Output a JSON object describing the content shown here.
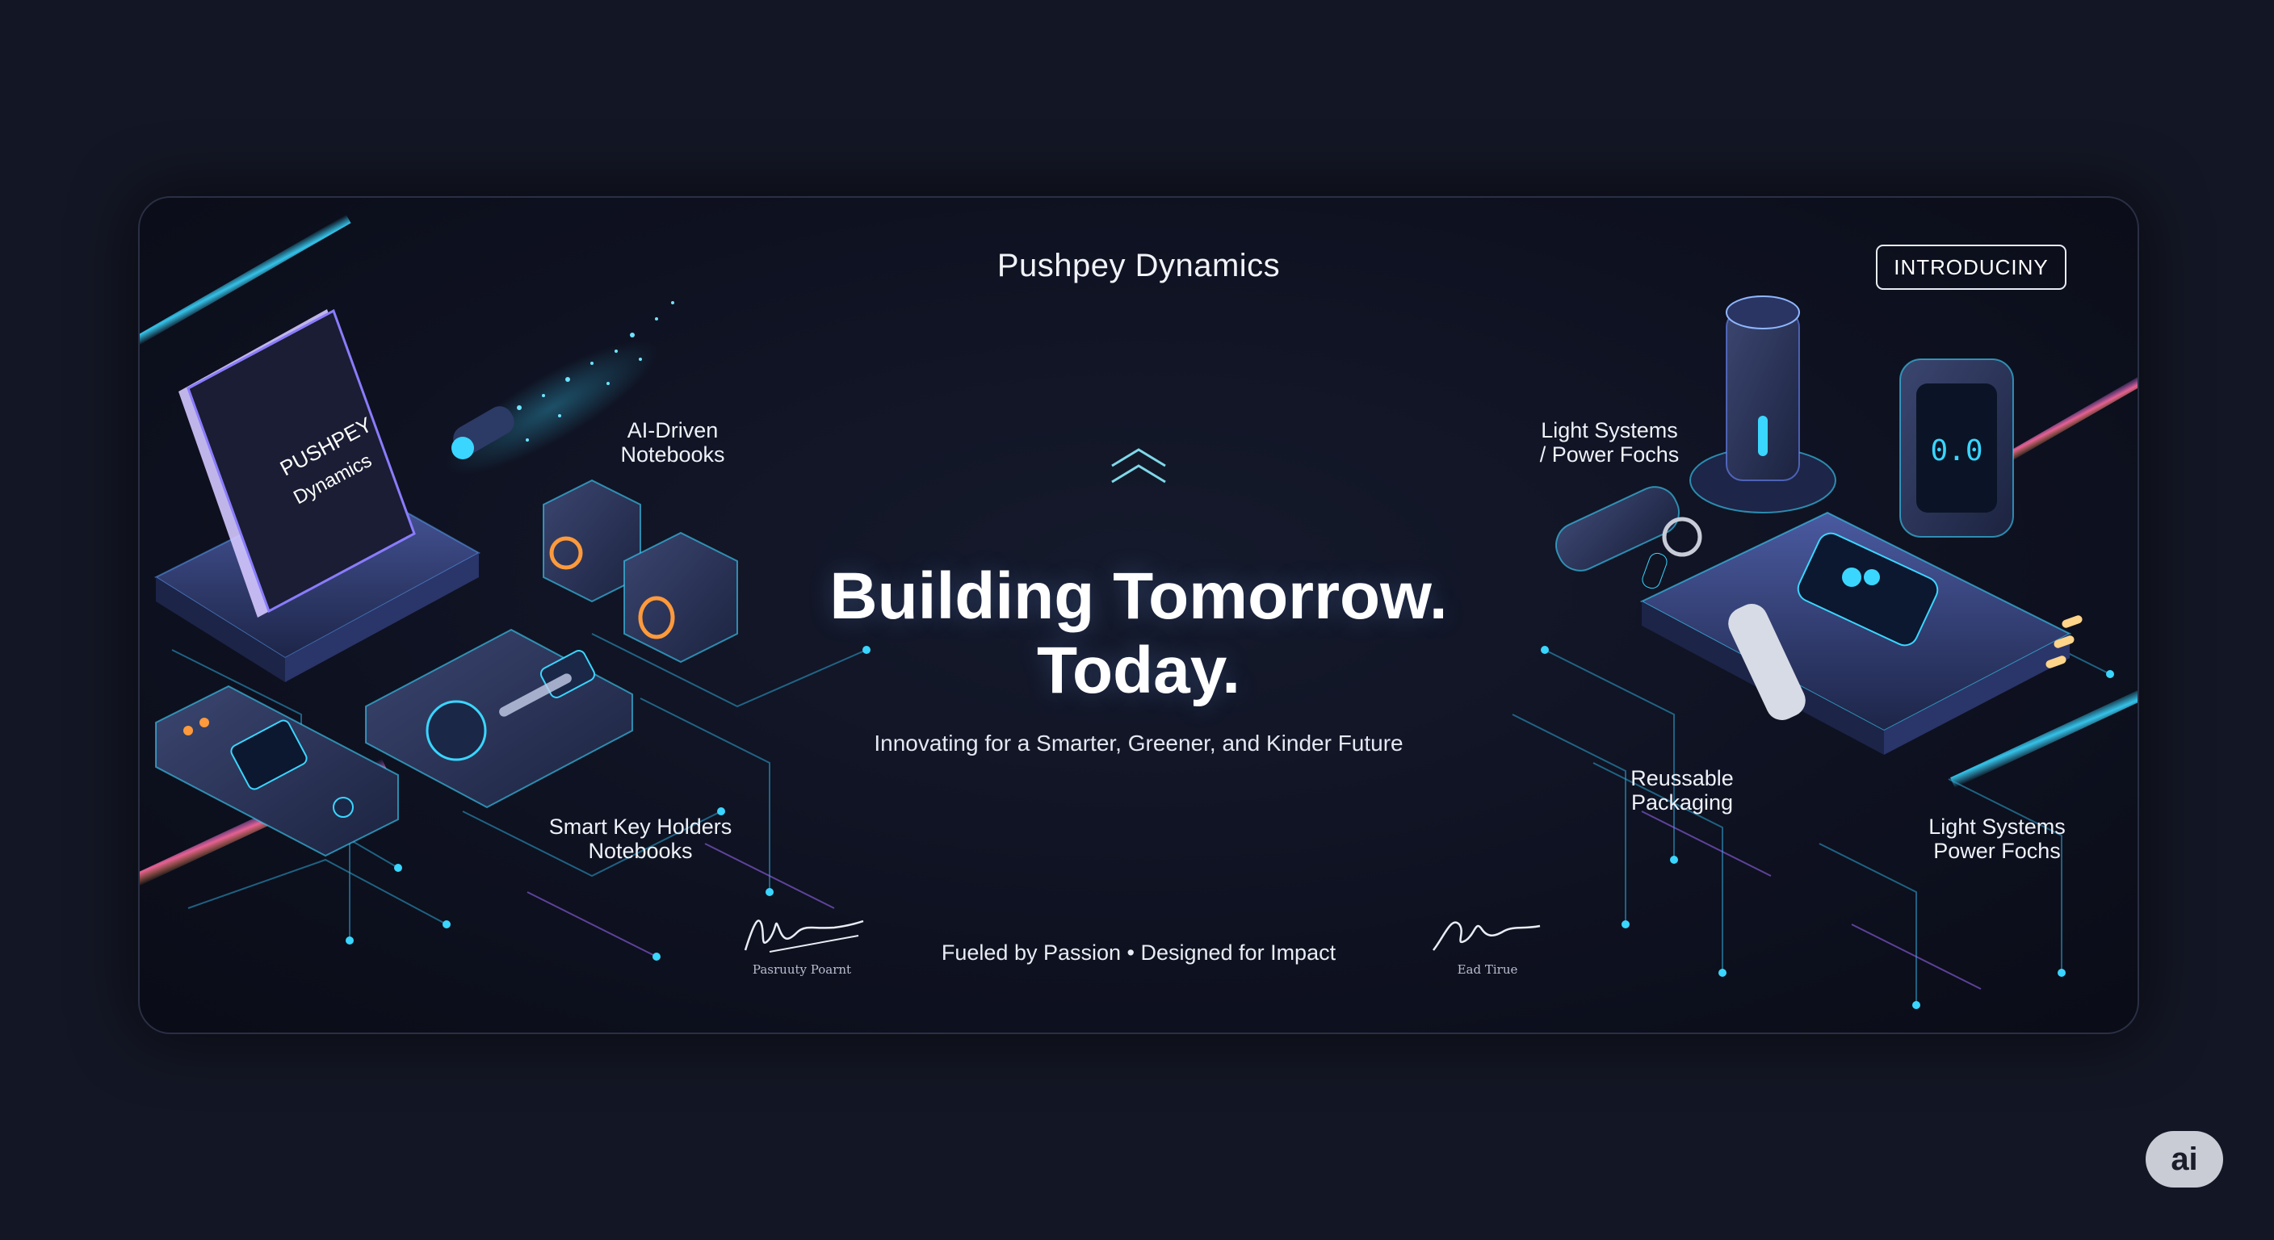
{
  "banner": {
    "brand": "Pushpey Dynamics",
    "badge": "INTRODUCINY",
    "headline_line1": "Building Tomorrow.",
    "headline_line2": "Today.",
    "subtitle": "Innovating for a Smarter, Greener, and Kinder Future",
    "footer_tagline": "Fueled by Passion • Designed for Impact",
    "notebook_text_line1": "PUSHPEY",
    "notebook_text_line2": "Dynamics",
    "signature_left_caption": "Pasruuty Poarnt",
    "signature_right_caption": "Ead Tirue",
    "labels": {
      "ai_notebooks_line1": "AI-Driven",
      "ai_notebooks_line2": "Notebooks",
      "smart_key_line1": "Smart Key Holders",
      "smart_key_line2": "Notebooks",
      "light_systems_top_line1": "Light Systems",
      "light_systems_top_line2": "/ Power Fochs",
      "reusable_line1": "Reussable",
      "reusable_line2": "Packaging",
      "light_systems_bottom_line1": "Light Systems",
      "light_systems_bottom_line2": "Power Fochs"
    },
    "device_readout": "0.0"
  },
  "corner_badge": "ai",
  "colors": {
    "page_bg": "#131624",
    "panel_bg": "#0e1120",
    "accent_cyan": "#3ad6ff",
    "accent_purple": "#a06bff",
    "accent_orange": "#ff9a3c"
  }
}
